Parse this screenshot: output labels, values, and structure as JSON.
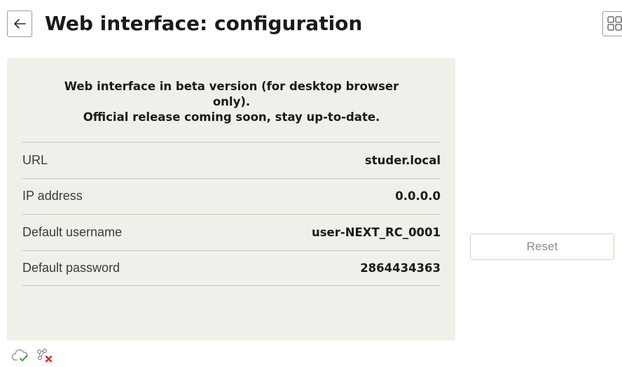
{
  "header": {
    "title": "Web interface: configuration",
    "back_icon": "arrow-left-icon",
    "menu_icon": "grid-icon"
  },
  "notice": {
    "line1": "Web interface in beta version (for desktop browser",
    "line2": "only).",
    "line3": "Official release coming soon, stay up-to-date."
  },
  "details": [
    {
      "label": "URL",
      "value": "studer.local"
    },
    {
      "label": "IP address",
      "value": "0.0.0.0"
    },
    {
      "label": "Default username",
      "value": "user-NEXT_RC_0001"
    },
    {
      "label": "Default password",
      "value": "2864434363"
    }
  ],
  "actions": {
    "reset_label": "Reset"
  },
  "status": {
    "cloud_icon": "cloud-check-icon",
    "network_icon": "network-disconnected-icon"
  },
  "colors": {
    "panel_bg": "#f0f0ea",
    "divider": "#c7c7bc",
    "accent_green": "#3aa83a",
    "error_red": "#e02020"
  }
}
